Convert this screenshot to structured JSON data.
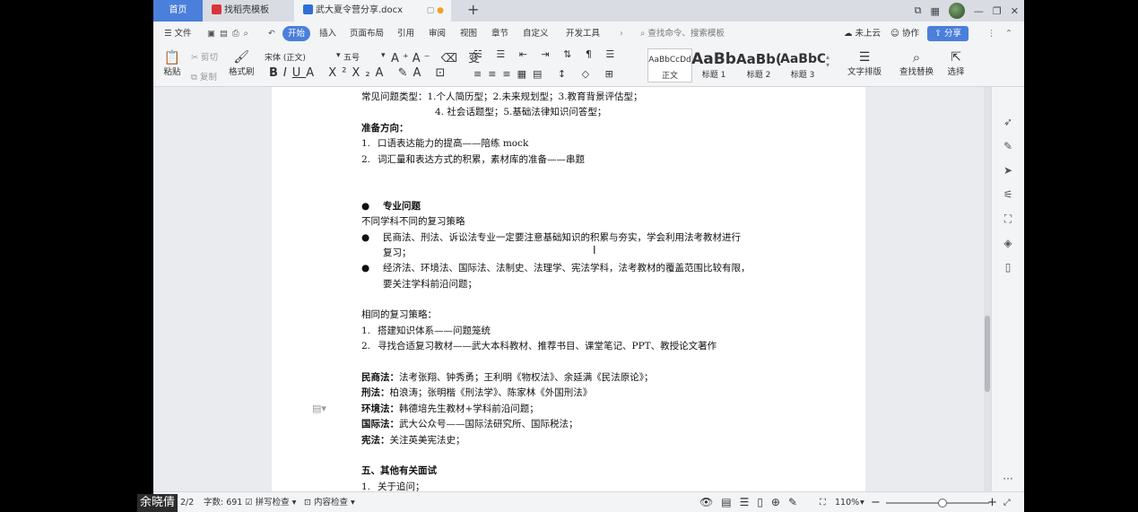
{
  "titlebar": {
    "tabs": [
      {
        "label": "首页"
      },
      {
        "label": "找稻壳模板"
      },
      {
        "label": "武大夏令营分享.docx"
      }
    ],
    "add_tab": "+"
  },
  "menubar": {
    "file": "文件",
    "items": [
      "开始",
      "插入",
      "页面布局",
      "引用",
      "审阅",
      "视图",
      "章节",
      "自定义",
      "开发工具"
    ],
    "search_placeholder": "查找命令、搜索模板",
    "cloud": "未上云",
    "collab": "协作",
    "share": "分享"
  },
  "ribbon": {
    "paste": "粘贴",
    "cut": "剪切",
    "copy": "复制",
    "format_painter": "格式刷",
    "font_name": "宋体 (正文)",
    "font_size": "五号",
    "styles": [
      {
        "preview": "AaBbCcDd",
        "label": "正文"
      },
      {
        "preview": "AaBb",
        "label": "标题 1"
      },
      {
        "preview": "AaBb(",
        "label": "标题 2"
      },
      {
        "preview": "AaBbC",
        "label": "标题 3"
      }
    ],
    "text_layout": "文字排版",
    "find_replace": "查找替换",
    "select": "选择"
  },
  "document": {
    "lines": [
      {
        "type": "text",
        "text": "常见问题类型：1.个人简历型；2.未来规划型；3.教育背景评估型；"
      },
      {
        "type": "indent",
        "text": "4. 社会话题型；5.基础法律知识问答型；"
      },
      {
        "type": "bold",
        "text": "准备方向："
      },
      {
        "type": "num",
        "n": "1.",
        "text": "口语表达能力的提高——陪练 mock"
      },
      {
        "type": "num",
        "n": "2.",
        "text": "词汇量和表达方式的积累，素材库的准备——串题"
      },
      {
        "type": "blank",
        "text": ""
      },
      {
        "type": "blank",
        "text": ""
      },
      {
        "type": "bullet-bold",
        "text": "专业问题"
      },
      {
        "type": "text",
        "text": "不同学科不同的复习策略"
      },
      {
        "type": "bullet",
        "text": "民商法、刑法、诉讼法专业一定要注意基础知识的积累与夯实，学会利用法考教材进行"
      },
      {
        "type": "cont",
        "text": "复习；"
      },
      {
        "type": "bullet",
        "text": "经济法、环境法、国际法、法制史、法理学、宪法学科，法考教材的覆盖范围比较有限，"
      },
      {
        "type": "cont",
        "text": "要关注学科前沿问题；"
      },
      {
        "type": "blank",
        "text": ""
      },
      {
        "type": "text",
        "text": "相同的复习策略："
      },
      {
        "type": "num",
        "n": "1.",
        "text": "搭建知识体系——问题笼统"
      },
      {
        "type": "num",
        "n": "2.",
        "text": "寻找合适复习教材——武大本科教材、推荐书目、课堂笔记、PPT、教授论文著作"
      },
      {
        "type": "blank",
        "text": ""
      },
      {
        "type": "label",
        "label": "民商法：",
        "text": "法考张翔、钟秀勇；王利明《物权法》、余延满《民法原论》；"
      },
      {
        "type": "label",
        "label": "刑法：",
        "text": "柏浪涛；张明楷《刑法学》、陈家林《外国刑法》"
      },
      {
        "type": "label",
        "label": "环境法：",
        "text": "韩德培先生教材+学科前沿问题；"
      },
      {
        "type": "label",
        "label": "国际法：",
        "text": "武大公众号——国际法研究所、国际税法；"
      },
      {
        "type": "label",
        "label": "宪法：",
        "text": "关注英美宪法史；"
      },
      {
        "type": "blank",
        "text": ""
      },
      {
        "type": "bold",
        "text": "五、其他有关面试"
      },
      {
        "type": "num",
        "n": "1.",
        "text": "关于追问；"
      }
    ]
  },
  "statusbar": {
    "page": "2/2",
    "word_count": "字数: 691",
    "spell_check": "拼写检查",
    "content_check": "内容检查",
    "zoom": "110%",
    "zoom_level": 0.55
  },
  "overlay": {
    "name": "余晓倩"
  }
}
